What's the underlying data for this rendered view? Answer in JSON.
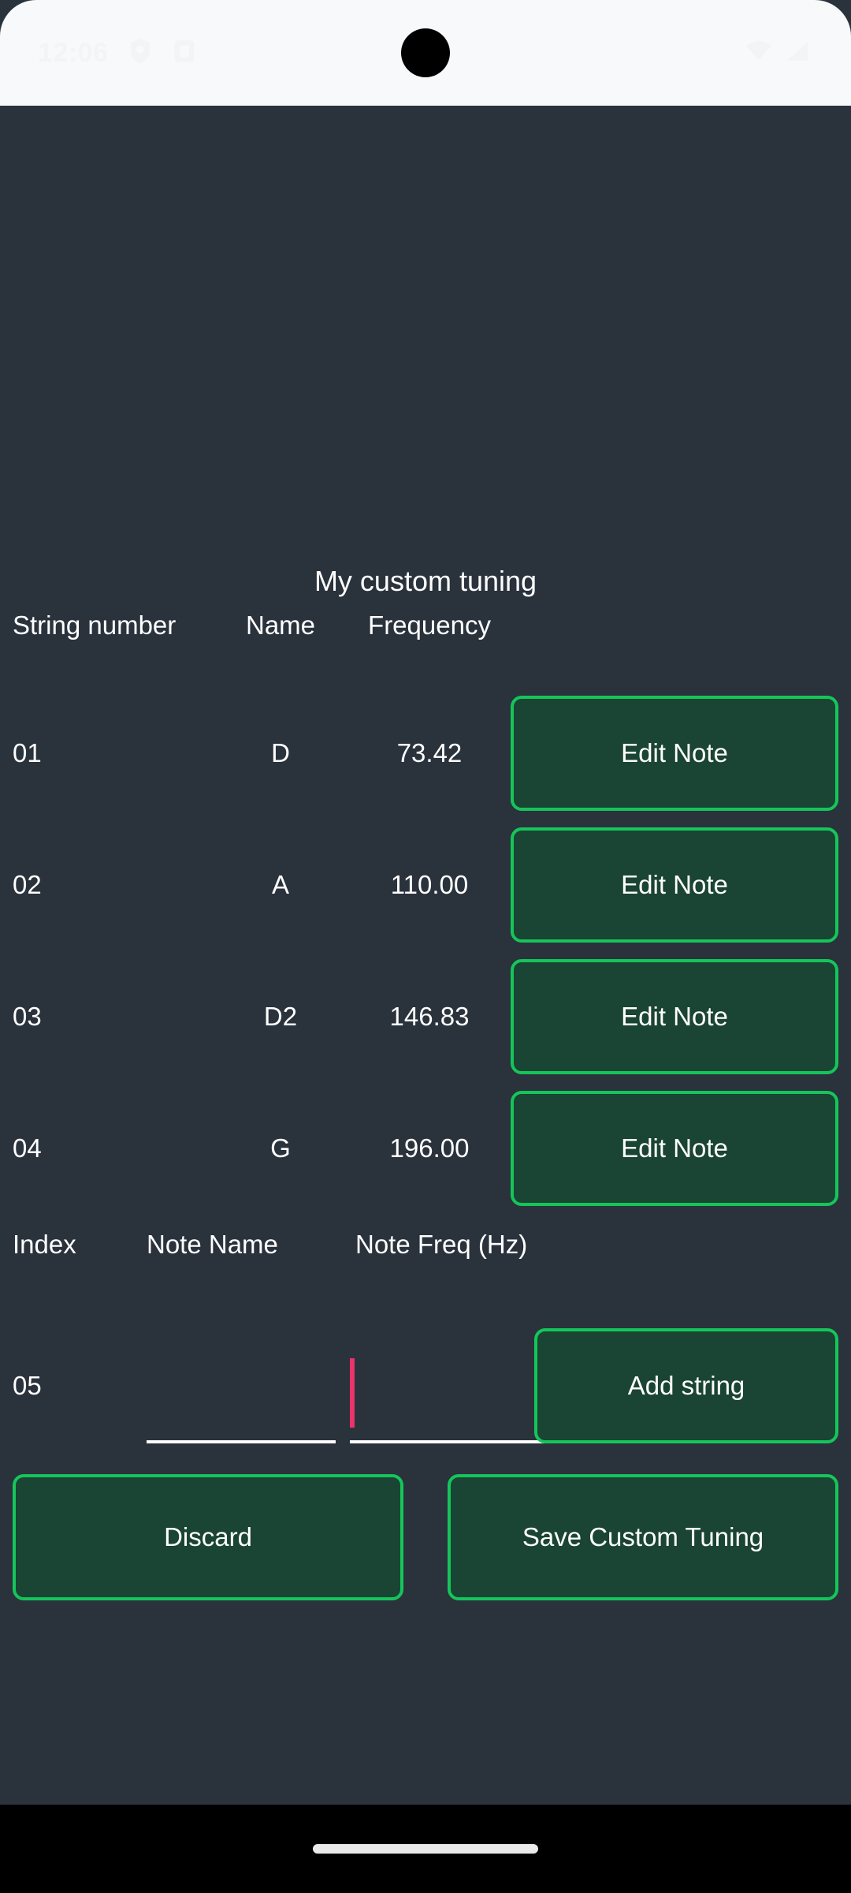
{
  "status_bar": {
    "time": "12:06",
    "left_icons": [
      "shield-vpn-icon",
      "app-notification-icon"
    ],
    "right_icons": [
      "wifi-icon",
      "cellular-signal-icon"
    ],
    "background_color": "#F8F9FA",
    "text_color": "#F2F4F6"
  },
  "screen": {
    "background_color": "#2A323C",
    "accent_green": "#15C55A",
    "button_fill": "#1A4433",
    "caret_color": "#E8336B",
    "text_color": "#FFFFFF"
  },
  "header": {
    "title": "My custom tuning"
  },
  "tuning_table": {
    "columns": {
      "number": "String number",
      "name": "Name",
      "frequency": "Frequency"
    },
    "rows": [
      {
        "number": "01",
        "name": "D",
        "frequency": "73.42",
        "action": "Edit Note"
      },
      {
        "number": "02",
        "name": "A",
        "frequency": "110.00",
        "action": "Edit Note"
      },
      {
        "number": "03",
        "name": "D2",
        "frequency": "146.83",
        "action": "Edit Note"
      },
      {
        "number": "04",
        "name": "G",
        "frequency": "196.00",
        "action": "Edit Note"
      }
    ]
  },
  "add_string": {
    "columns": {
      "index": "Index",
      "note_name": "Note Name",
      "note_freq": "Note Freq (Hz)"
    },
    "index": "05",
    "note_name_value": "",
    "note_name_placeholder": "",
    "note_freq_value": "",
    "note_freq_placeholder": "",
    "add_button": "Add string"
  },
  "actions": {
    "discard": "Discard",
    "save": "Save Custom Tuning"
  },
  "nav_bar": {
    "gesture_pill": "home-gesture-pill"
  }
}
